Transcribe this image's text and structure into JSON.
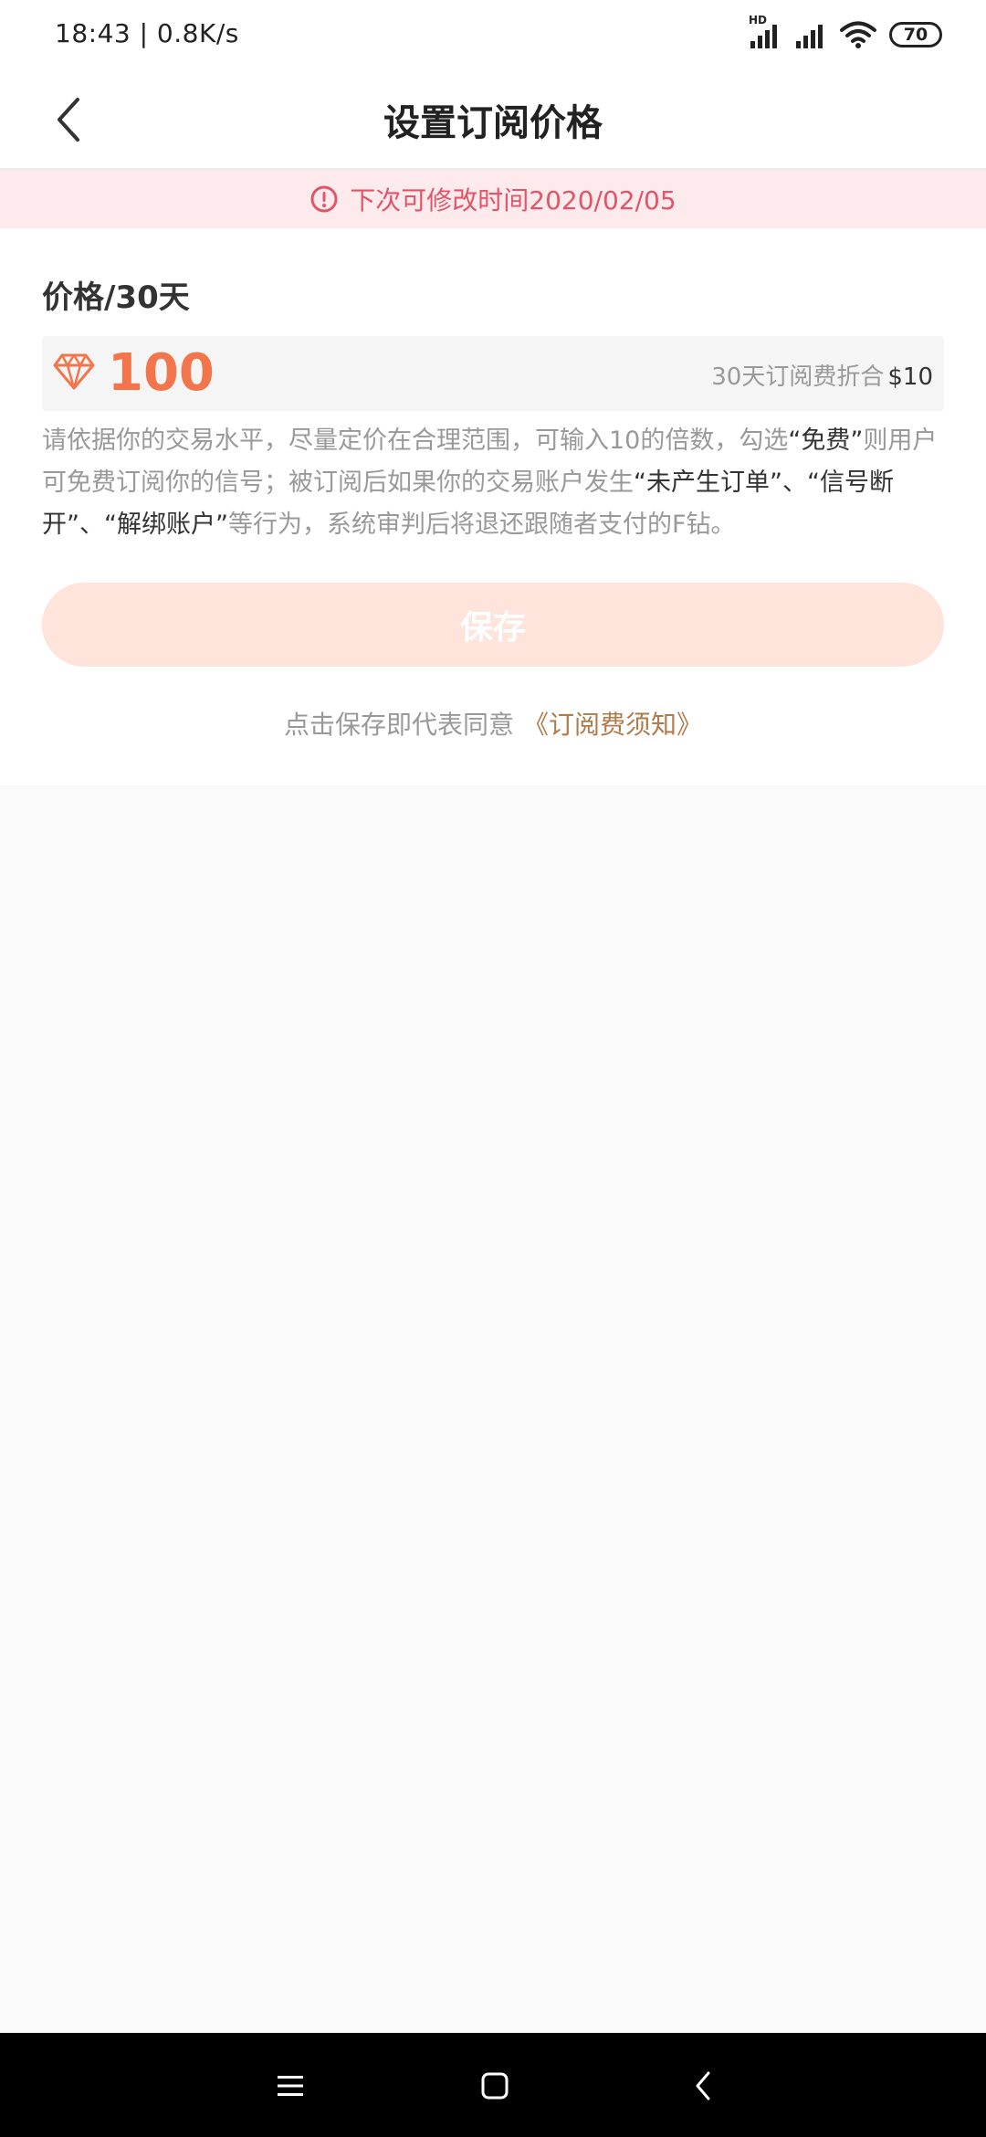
{
  "status_bar": {
    "time_speed": "18:43 | 0.8K/s",
    "hd_label": "HD",
    "battery": "70"
  },
  "header": {
    "title": "设置订阅价格"
  },
  "notice": {
    "text": "下次可修改时间2020/02/05",
    "color": "#e05668"
  },
  "price": {
    "label": "价格/30天",
    "value": "100",
    "convert_label": "30天订阅费折合",
    "convert_amount": "$10",
    "accent_color": "#f2754c"
  },
  "help": {
    "part1": "请依据你的交易水平，尽量定价在合理范围，可输入10的倍数，勾选",
    "hl1": "“免费”",
    "part2": "则用户可免费订阅你的信号；被订阅后如果你的交易账户发生",
    "hl2": "“未产生订单”、“信号断开”、“解绑账户”",
    "part3": "等行为，系统审判后将退还跟随者支付的F钻。"
  },
  "save": {
    "label": "保存",
    "disabled_color": "#fee4da"
  },
  "agreement": {
    "prefix": "点击保存即代表同意",
    "link": "《订阅费须知》"
  },
  "icons": {
    "back": "chevron-left-icon",
    "notice": "alert-circle-icon",
    "price": "diamond-icon",
    "nav_menu": "menu-icon",
    "nav_home": "home-square-icon",
    "nav_back": "back-arrow-icon"
  }
}
